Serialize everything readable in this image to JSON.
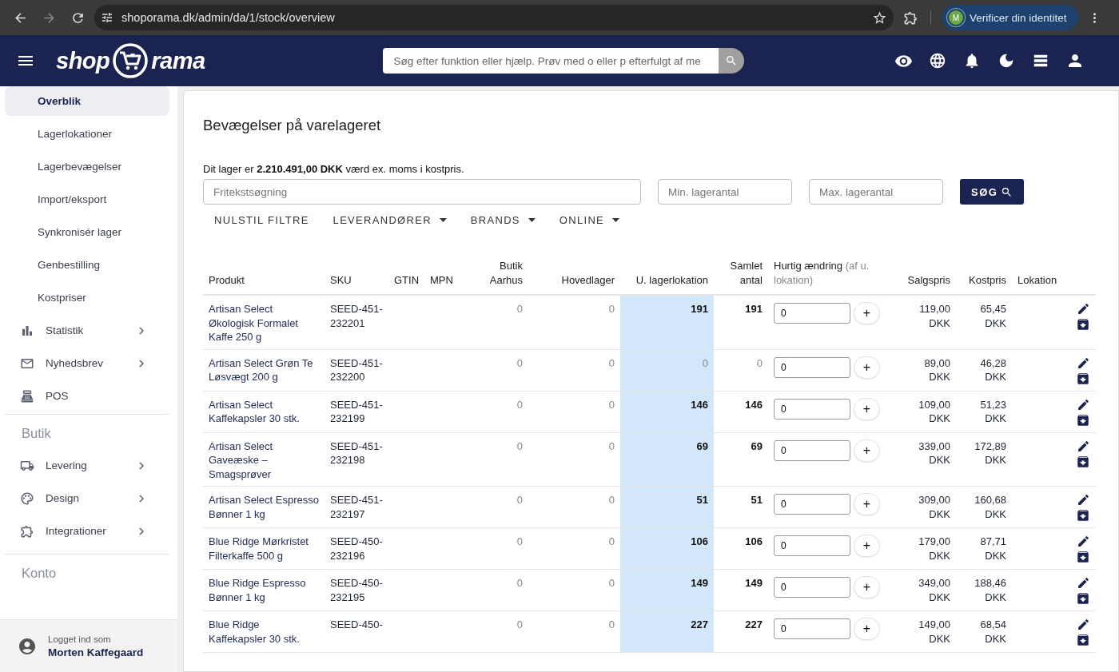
{
  "browser": {
    "url": "shoporama.dk/admin/da/1/stock/overview",
    "profile_initial": "M",
    "profile_label": "Verificer din identitet"
  },
  "header": {
    "logo_left": "shop",
    "logo_right": "rama",
    "search_placeholder": "Søg efter funktion eller hjælp. Prøv med o eller p efterfulgt af me"
  },
  "sidebar": {
    "sections": [
      {
        "items": [
          {
            "kind": "sub",
            "label": "Overblik",
            "selected": true
          },
          {
            "kind": "sub",
            "label": "Lagerlokationer",
            "selected": false
          },
          {
            "kind": "sub",
            "label": "Lagerbevægelser",
            "selected": false
          },
          {
            "kind": "sub",
            "label": "Import/eksport",
            "selected": false
          },
          {
            "kind": "sub",
            "label": "Synkronisér lager",
            "selected": false
          },
          {
            "kind": "sub",
            "label": "Genbestilling",
            "selected": false
          },
          {
            "kind": "sub",
            "label": "Kostpriser",
            "selected": false
          },
          {
            "kind": "nav",
            "label": "Statistik",
            "selected": false,
            "expandable": true
          },
          {
            "kind": "nav",
            "label": "Nyhedsbrev",
            "selected": false,
            "expandable": true
          },
          {
            "kind": "nav",
            "label": "POS",
            "selected": false,
            "expandable": false
          }
        ]
      },
      {
        "title": "Butik",
        "items": [
          {
            "kind": "nav",
            "label": "Levering",
            "selected": false,
            "expandable": true
          },
          {
            "kind": "nav",
            "label": "Design",
            "selected": false,
            "expandable": true
          },
          {
            "kind": "nav",
            "label": "Integrationer",
            "selected": false,
            "expandable": true
          }
        ]
      },
      {
        "title": "Konto"
      }
    ],
    "user": {
      "caption": "Logget ind som",
      "name": "Morten Kaffegaard"
    }
  },
  "page": {
    "title": "Bevægelser på varelageret",
    "summary": "Dit lager er **2.210.491,00 DKK** værd ex. moms i kostpris.",
    "search_placeholder": "Fritekstsøgning",
    "min_placeholder": "Min. lagerantal",
    "max_placeholder": "Max. lagerantal",
    "search_button": "SØG",
    "filters": [
      {
        "label": "NULSTIL FILTRE",
        "has_menu": false
      },
      {
        "label": "LEVERANDØRER",
        "has_menu": true
      },
      {
        "label": "BRANDS",
        "has_menu": true
      },
      {
        "label": "ONLINE",
        "has_menu": true
      }
    ]
  },
  "table": {
    "add_label": "+",
    "columns": [
      {
        "label": "Produkt"
      },
      {
        "label": "SKU"
      },
      {
        "label": "GTIN"
      },
      {
        "label": "MPN"
      },
      {
        "label": "Butik Aarhus"
      },
      {
        "label": "Hovedlager"
      },
      {
        "label": "U. lagerlokation"
      },
      {
        "label": "Samlet antal"
      },
      {
        "label": "Hurtig ændring",
        "note": "(af u. lokation)"
      },
      {
        "label": "Salgspris"
      },
      {
        "label": "Kostpris"
      },
      {
        "label": "Lokation"
      }
    ],
    "rows": [
      {
        "product": "Artisan Select Økologisk Formalet Kaffe 250 g",
        "sku": "SEED-451-232201",
        "butik": "0",
        "hovedlager": "0",
        "unlocated": "191",
        "total": "191",
        "empty": false,
        "quick": "0",
        "price": "119,00 DKK",
        "cost": "65,45 DKK"
      },
      {
        "product": "Artisan Select Grøn Te Løsvægt 200 g",
        "sku": "SEED-451-232200",
        "butik": "0",
        "hovedlager": "0",
        "unlocated": "0",
        "total": "0",
        "empty": true,
        "quick": "0",
        "price": "89,00 DKK",
        "cost": "46,28 DKK"
      },
      {
        "product": "Artisan Select Kaffekapsler 30 stk.",
        "sku": "SEED-451-232199",
        "butik": "0",
        "hovedlager": "0",
        "unlocated": "146",
        "total": "146",
        "empty": false,
        "quick": "0",
        "price": "109,00 DKK",
        "cost": "51,23 DKK"
      },
      {
        "product": "Artisan Select Gaveæske – Smagsprøver",
        "sku": "SEED-451-232198",
        "butik": "0",
        "hovedlager": "0",
        "unlocated": "69",
        "total": "69",
        "empty": false,
        "quick": "0",
        "price": "339,00 DKK",
        "cost": "172,89 DKK"
      },
      {
        "product": "Artisan Select Espresso Bønner 1 kg",
        "sku": "SEED-451-232197",
        "butik": "0",
        "hovedlager": "0",
        "unlocated": "51",
        "total": "51",
        "empty": false,
        "quick": "0",
        "price": "309,00 DKK",
        "cost": "160,68 DKK"
      },
      {
        "product": "Blue Ridge Mørkristet Filterkaffe 500 g",
        "sku": "SEED-450-232196",
        "butik": "0",
        "hovedlager": "0",
        "unlocated": "106",
        "total": "106",
        "empty": false,
        "quick": "0",
        "price": "179,00 DKK",
        "cost": "87,71 DKK"
      },
      {
        "product": "Blue Ridge Espresso Bønner 1 kg",
        "sku": "SEED-450-232195",
        "butik": "0",
        "hovedlager": "0",
        "unlocated": "149",
        "total": "149",
        "empty": false,
        "quick": "0",
        "price": "349,00 DKK",
        "cost": "188,46 DKK"
      },
      {
        "product": "Blue Ridge Kaffekapsler 30 stk.",
        "sku": "SEED-450-",
        "butik": "0",
        "hovedlager": "0",
        "unlocated": "227",
        "total": "227",
        "empty": false,
        "quick": "0",
        "price": "149,00 DKK",
        "cost": "68,54 DKK"
      }
    ]
  }
}
